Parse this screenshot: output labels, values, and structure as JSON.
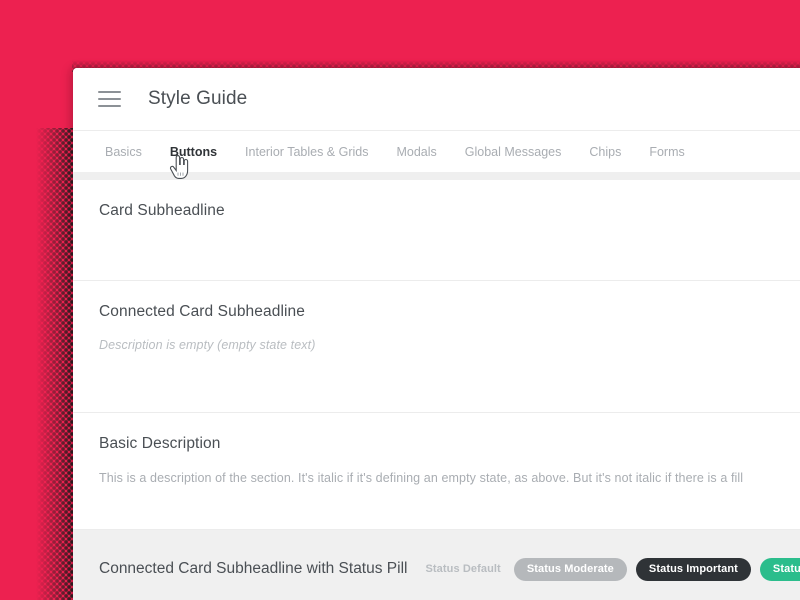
{
  "theme": {
    "backdrop_color": "#ED2150",
    "card_background": "#FFFFFF",
    "accent_green": "#2BBD8C",
    "pill_moderate_color": "#B5B8BB",
    "pill_important_color": "#2F3337",
    "muted_text_color": "#A9ADB2"
  },
  "header": {
    "menu_icon": "hamburger-menu-icon",
    "title": "Style Guide"
  },
  "tabs": [
    {
      "label": "Basics",
      "active": false
    },
    {
      "label": "Buttons",
      "active": true
    },
    {
      "label": "Interior Tables & Grids",
      "active": false
    },
    {
      "label": "Modals",
      "active": false
    },
    {
      "label": "Global Messages",
      "active": false
    },
    {
      "label": "Chips",
      "active": false
    },
    {
      "label": "Forms",
      "active": false
    }
  ],
  "cursor": {
    "icon": "pointing-hand-cursor",
    "over_tab": "Buttons"
  },
  "sections": {
    "card": {
      "subheadline": "Card Subheadline"
    },
    "connected_card": {
      "subheadline": "Connected Card Subheadline",
      "empty_state_text": "Description is empty  (empty state text)"
    },
    "basic": {
      "subheadline": "Basic Description",
      "description": "This is a description of the section. It's italic if it's defining an empty state, as above. But it's not italic if there is a fill"
    },
    "status_pill_card": {
      "subheadline": "Connected Card Subheadline with Status Pill",
      "pills": [
        {
          "label": "Status Default",
          "style": "default"
        },
        {
          "label": "Status Moderate",
          "style": "moderate"
        },
        {
          "label": "Status Important",
          "style": "important"
        },
        {
          "label": "Status Goo",
          "style": "good"
        }
      ]
    }
  }
}
